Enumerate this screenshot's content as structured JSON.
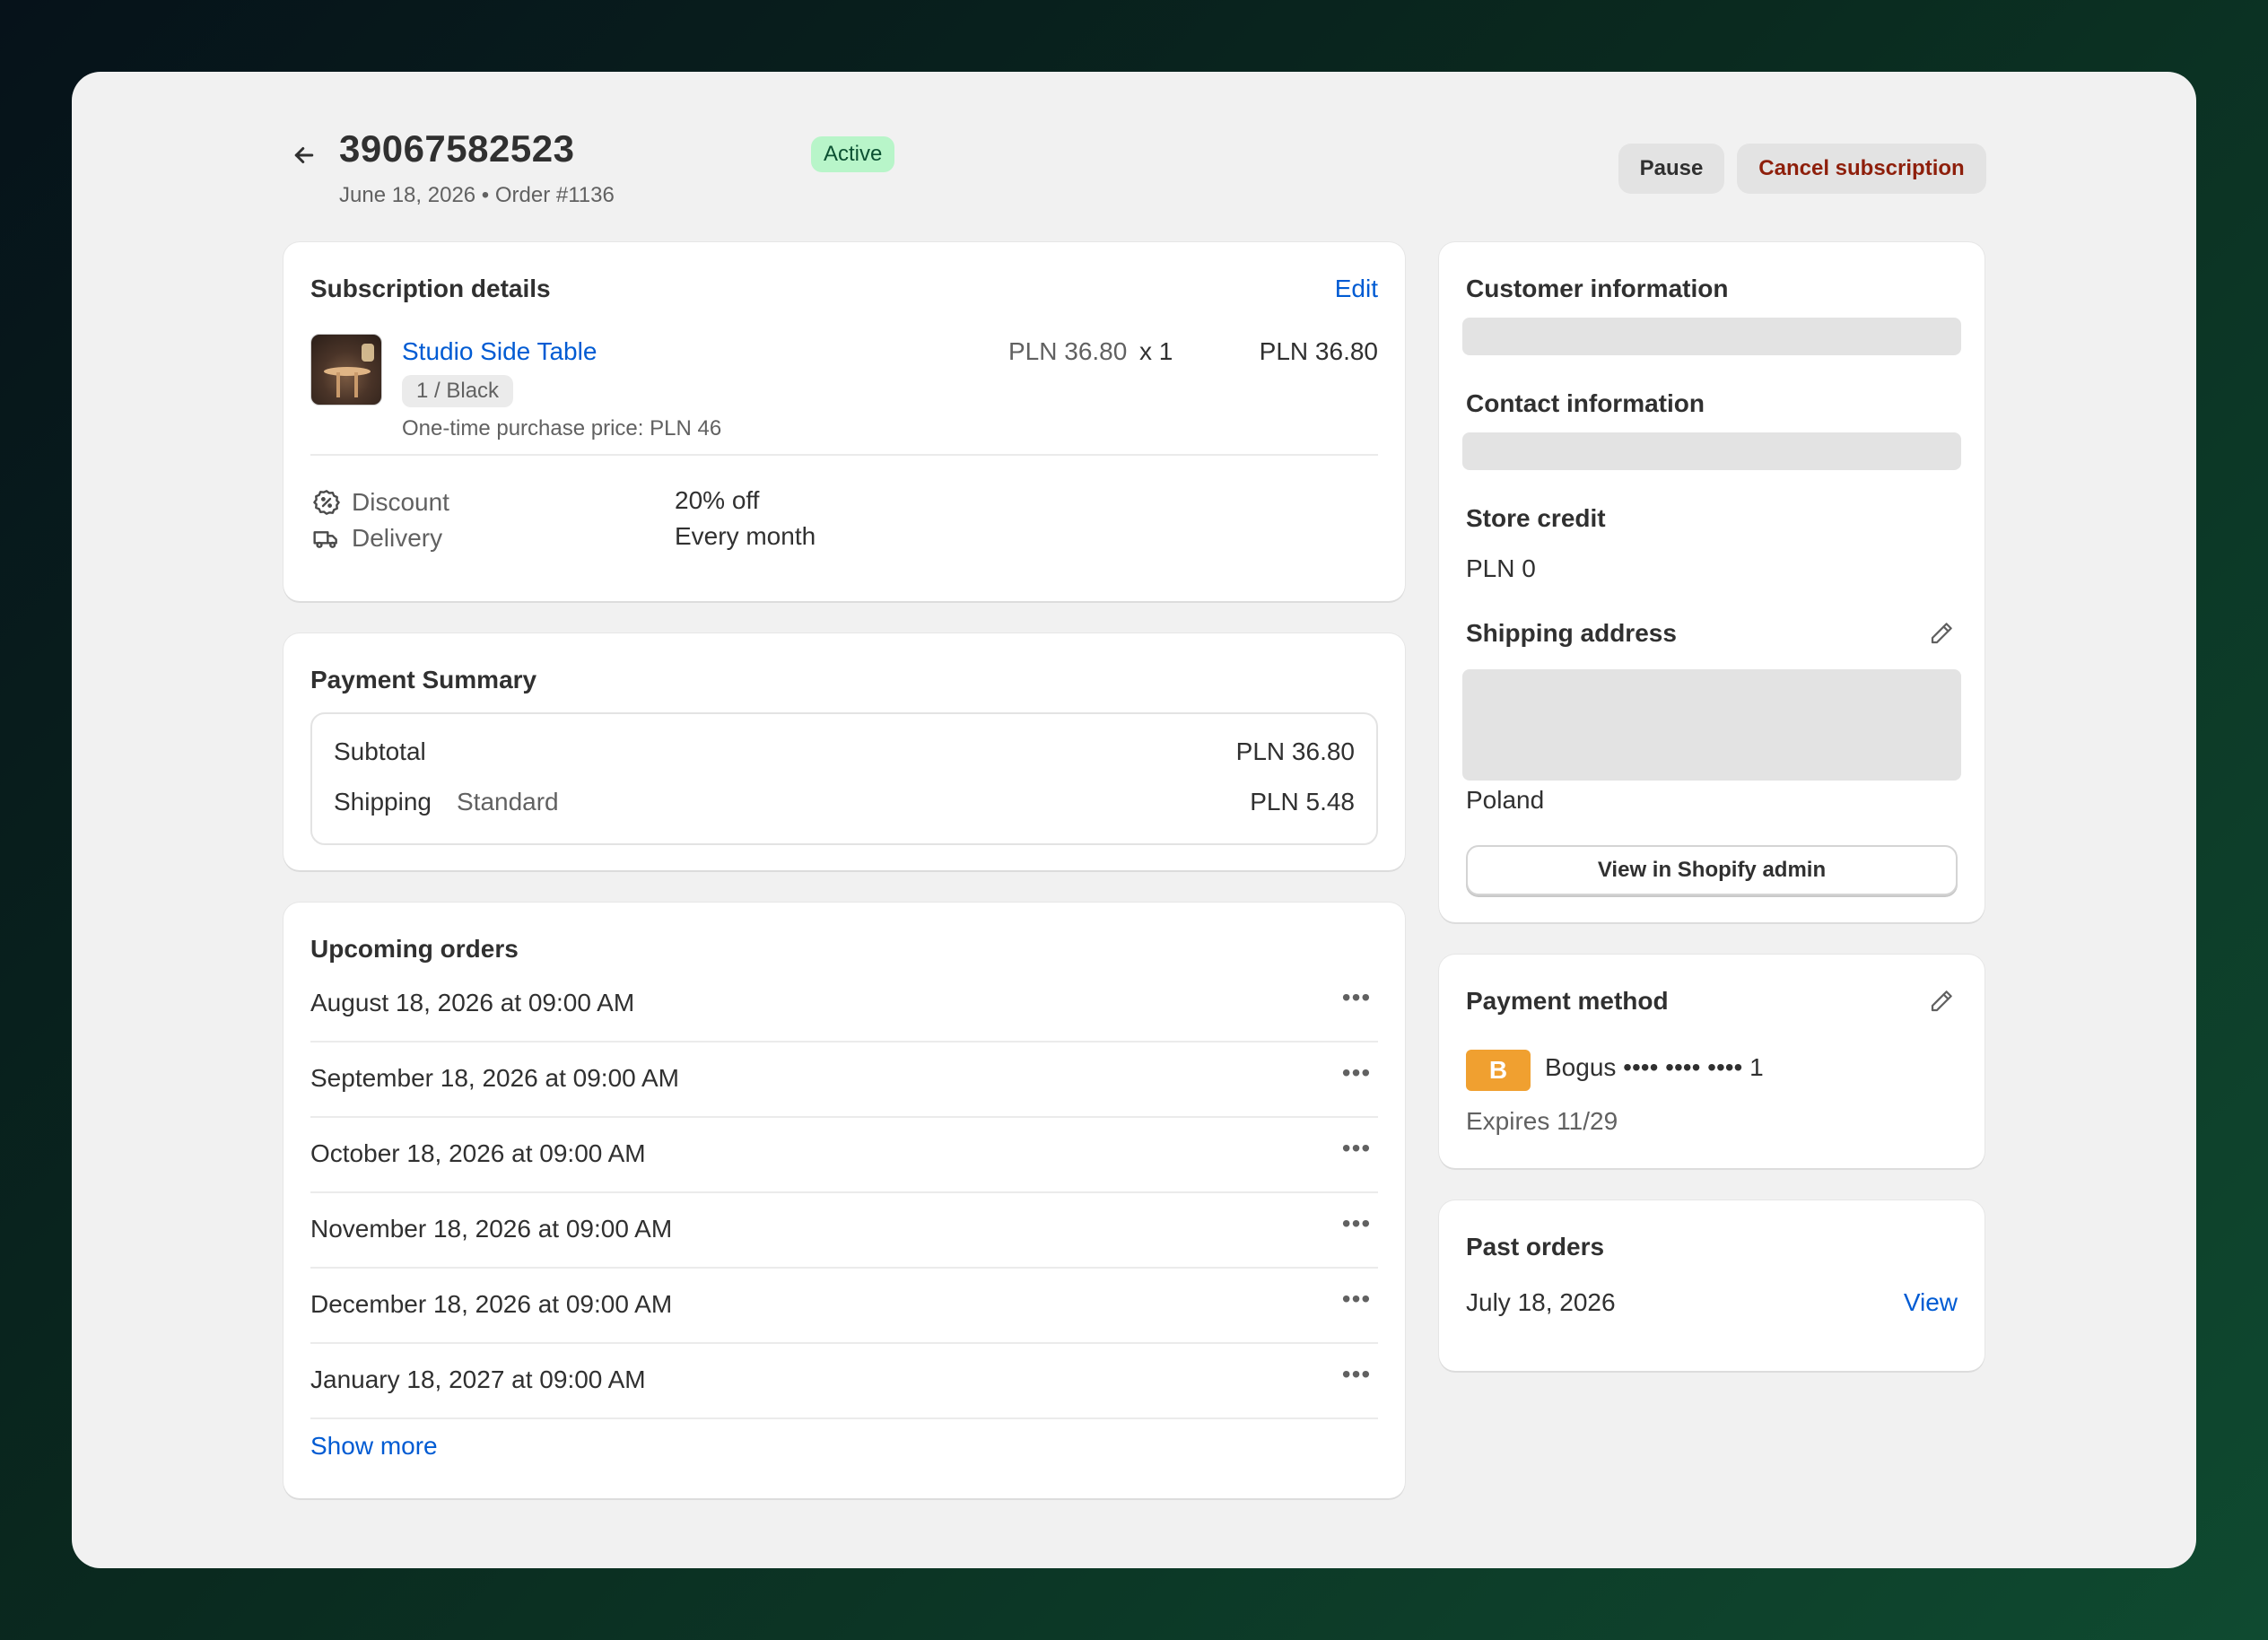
{
  "header": {
    "title": "39067582523",
    "status": "Active",
    "subtitle": "June 18, 2026 • Order #1136",
    "pause_label": "Pause",
    "cancel_label": "Cancel subscription"
  },
  "subscription": {
    "title": "Subscription details",
    "edit_label": "Edit",
    "product_name": "Studio Side Table",
    "variant": "1 / Black",
    "one_time_price": "One-time purchase price: PLN 46",
    "unit_price": "PLN 36.80",
    "quantity": "x  1",
    "line_total": "PLN 36.80",
    "discount_label": "Discount",
    "discount_value": "20% off",
    "delivery_label": "Delivery",
    "delivery_value": "Every month"
  },
  "payment_summary": {
    "title": "Payment Summary",
    "subtotal_label": "Subtotal",
    "subtotal_value": "PLN 36.80",
    "shipping_label": "Shipping",
    "shipping_method": "Standard",
    "shipping_value": "PLN 5.48"
  },
  "upcoming": {
    "title": "Upcoming orders",
    "orders": [
      "August 18, 2026 at 09:00 AM",
      "September 18, 2026 at 09:00 AM",
      "October 18, 2026 at 09:00 AM",
      "November 18, 2026 at 09:00 AM",
      "December 18, 2026 at 09:00 AM",
      "January 18, 2027 at 09:00 AM"
    ],
    "more_glyph": "•••",
    "show_more_label": "Show more"
  },
  "customer": {
    "title": "Customer information",
    "contact_title": "Contact information",
    "store_credit_title": "Store credit",
    "store_credit_value": "PLN 0",
    "shipping_title": "Shipping address",
    "country": "Poland",
    "admin_button": "View in Shopify admin"
  },
  "payment_method": {
    "title": "Payment method",
    "brand_letter": "B",
    "card_label": "Bogus •••• •••• •••• 1",
    "expires": "Expires 11/29",
    "brand_color": "#f0a030"
  },
  "past_orders": {
    "title": "Past orders",
    "date": "July 18, 2026",
    "view_label": "View"
  },
  "colors": {
    "accent_link": "#005bd3",
    "active_badge_bg": "#b8f5c9",
    "cancel_text": "#8e1f0b"
  }
}
